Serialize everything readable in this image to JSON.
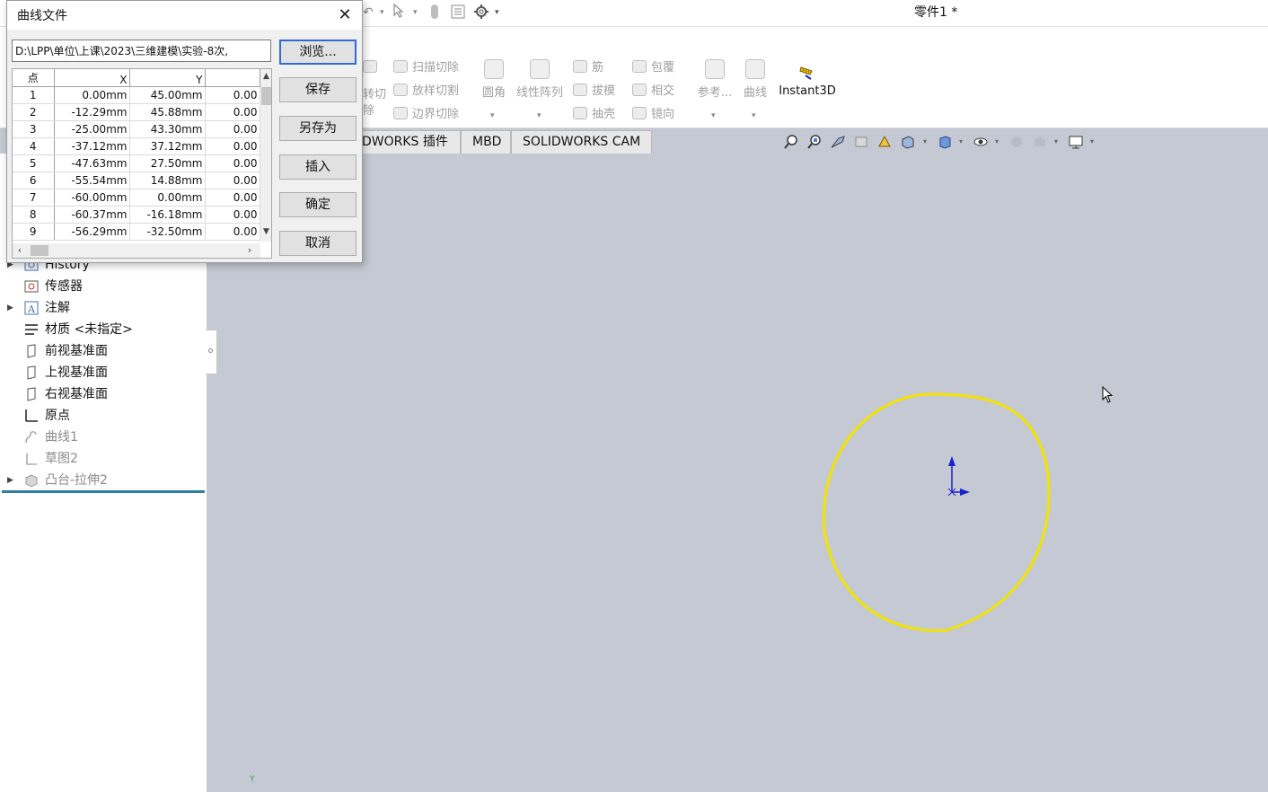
{
  "window": {
    "doc_title": "零件1 *"
  },
  "ribbon": {
    "small_buttons": [
      {
        "label": "扫描切除",
        "icon": "sweep-cut-icon"
      },
      {
        "label": "放样切割",
        "icon": "loft-cut-icon"
      },
      {
        "label": "边界切除",
        "icon": "boundary-cut-icon"
      },
      {
        "label": "筋",
        "icon": "rib-icon"
      },
      {
        "label": "拔模",
        "icon": "draft-icon"
      },
      {
        "label": "抽壳",
        "icon": "shell-icon"
      },
      {
        "label": "包覆",
        "icon": "wrap-icon"
      },
      {
        "label": "相交",
        "icon": "intersect-icon"
      },
      {
        "label": "镜向",
        "icon": "mirror-icon"
      }
    ],
    "big_buttons": [
      {
        "label": "圆角",
        "icon": "fillet-icon"
      },
      {
        "label": "线性阵列",
        "icon": "linear-pattern-icon"
      },
      {
        "label": "参考...",
        "icon": "reference-geometry-icon"
      },
      {
        "label": "曲线",
        "icon": "curves-icon"
      }
    ],
    "partial_cut_label_line1": "转切",
    "partial_cut_label_line2": "除",
    "instant3d_label": "Instant3D"
  },
  "tabs": [
    {
      "label": "DWORKS 插件"
    },
    {
      "label": "MBD"
    },
    {
      "label": "SOLIDWORKS CAM"
    }
  ],
  "tree": {
    "items": [
      {
        "label": "History",
        "icon": "history-icon",
        "expandable": true
      },
      {
        "label": "传感器",
        "icon": "sensor-icon",
        "expandable": false
      },
      {
        "label": "注解",
        "icon": "annotation-icon",
        "expandable": true
      },
      {
        "label": "材质 <未指定>",
        "icon": "material-icon",
        "expandable": false
      },
      {
        "label": "前视基准面",
        "icon": "plane-icon",
        "expandable": false
      },
      {
        "label": "上视基准面",
        "icon": "plane-icon",
        "expandable": false
      },
      {
        "label": "右视基准面",
        "icon": "plane-icon",
        "expandable": false
      },
      {
        "label": "原点",
        "icon": "origin-icon",
        "expandable": false
      },
      {
        "label": "曲线1",
        "icon": "curve-icon",
        "expandable": false
      },
      {
        "label": "草图2",
        "icon": "sketch-icon",
        "expandable": false
      },
      {
        "label": "凸台-拉伸2",
        "icon": "extrude-icon",
        "expandable": true
      }
    ]
  },
  "dialog": {
    "title": "曲线文件",
    "path_value": "D:\\LPP\\单位\\上课\\2023\\三维建模\\实验-8次,",
    "buttons": {
      "browse": "浏览...",
      "save": "保存",
      "save_as": "另存为",
      "insert": "插入",
      "ok": "确定",
      "cancel": "取消"
    },
    "table": {
      "headers": [
        "点",
        "X",
        "Y",
        ""
      ],
      "rows": [
        [
          "1",
          "0.00mm",
          "45.00mm",
          "0.00"
        ],
        [
          "2",
          "-12.29mm",
          "45.88mm",
          "0.00"
        ],
        [
          "3",
          "-25.00mm",
          "43.30mm",
          "0.00"
        ],
        [
          "4",
          "-37.12mm",
          "37.12mm",
          "0.00"
        ],
        [
          "5",
          "-47.63mm",
          "27.50mm",
          "0.00"
        ],
        [
          "6",
          "-55.54mm",
          "14.88mm",
          "0.00"
        ],
        [
          "7",
          "-60.00mm",
          "0.00mm",
          "0.00"
        ],
        [
          "8",
          "-60.37mm",
          "-16.18mm",
          "0.00"
        ],
        [
          "9",
          "-56.29mm",
          "-32.50mm",
          "0.00"
        ]
      ]
    }
  },
  "viewport": {
    "curve_color": "#f2e400",
    "background_color": "#c4c9d3",
    "triad_color": "#1a22c8",
    "y_axis_label": "Y"
  }
}
